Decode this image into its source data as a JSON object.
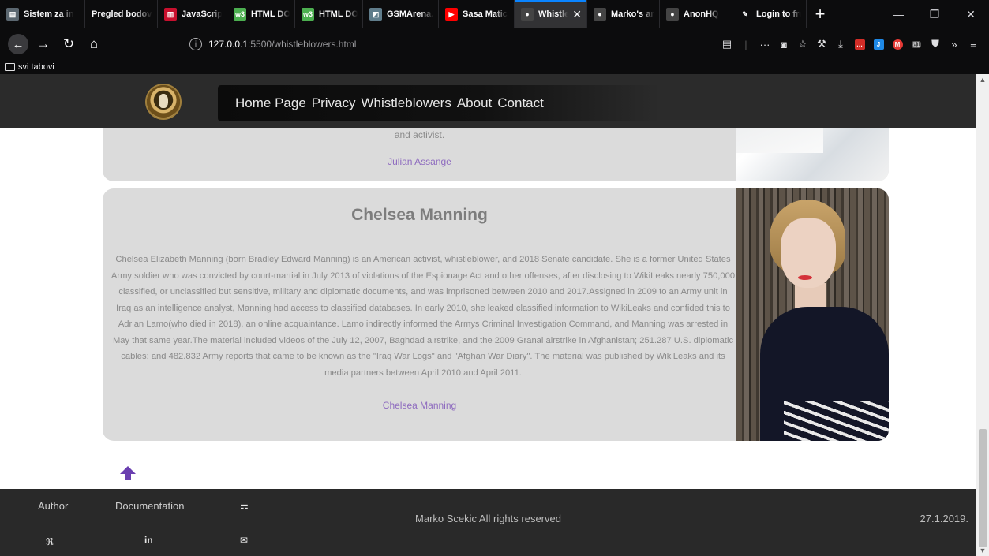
{
  "browser": {
    "tabs": [
      {
        "title": "Sistem za in",
        "color": "#5b6770",
        "glyph": "▤"
      },
      {
        "title": "Pregled bodova",
        "color": "",
        "glyph": ""
      },
      {
        "title": "JavaScript C",
        "color": "#c8102e",
        "glyph": "▥"
      },
      {
        "title": "HTML DOM",
        "color": "#4caf50",
        "glyph": "w3"
      },
      {
        "title": "HTML DOM",
        "color": "#4caf50",
        "glyph": "w3"
      },
      {
        "title": "GSMArena.c",
        "color": "#607d8b",
        "glyph": "◩"
      },
      {
        "title": "Sasa Matic",
        "color": "#ff0000",
        "glyph": "▶"
      },
      {
        "title": "Whistleb",
        "color": "#444",
        "glyph": "●",
        "active": true
      },
      {
        "title": "Marko's anc",
        "color": "#444",
        "glyph": "●"
      },
      {
        "title": "AnonHQ",
        "color": "#444",
        "glyph": "●"
      },
      {
        "title": "Login to fre",
        "color": "",
        "glyph": "✎"
      }
    ],
    "url_host": "127.0.0.1",
    "url_path": ":5500/whistleblowers.html",
    "bookmark_folder": "svi tabovi",
    "badge_count": "81"
  },
  "site": {
    "nav": [
      "Home Page",
      "Privacy",
      "Whistleblowers",
      "About",
      "Contact"
    ],
    "card1": {
      "tail": "and activist.",
      "link": "Julian Assange"
    },
    "card2": {
      "title": "Chelsea Manning",
      "text": "Chelsea Elizabeth Manning (born Bradley Edward Manning) is an American activist, whistleblower, and 2018 Senate candidate. She is a former United States Army soldier who was convicted by court-martial in July 2013 of violations of the Espionage Act and other offenses, after disclosing to WikiLeaks nearly 750,000 classified, or unclassified but sensitive, military and diplomatic documents, and was imprisoned between 2010 and 2017.Assigned in 2009 to an Army unit in Iraq as an intelligence analyst, Manning had access to classified databases. In early 2010, she leaked classified information to WikiLeaks and confided this to Adrian Lamo(who died in 2018), an online acquaintance. Lamo indirectly informed the Armys Criminal Investigation Command, and Manning was arrested in May that same year.The material included videos of the July 12, 2007, Baghdad airstrike, and the 2009 Granai airstrike in Afghanistan; 251.287 U.S. diplomatic cables; and 482.832 Army reports that came to be known as the \"Iraq War Logs\" and \"Afghan War Diary\". The material was published by WikiLeaks and its media partners between April 2010 and April 2011.",
      "link": "Chelsea Manning"
    },
    "footer": {
      "author": "Author",
      "documentation": "Documentation",
      "copyright": "Marko Scekic All rights reserved",
      "date": "27.1.2019."
    }
  }
}
